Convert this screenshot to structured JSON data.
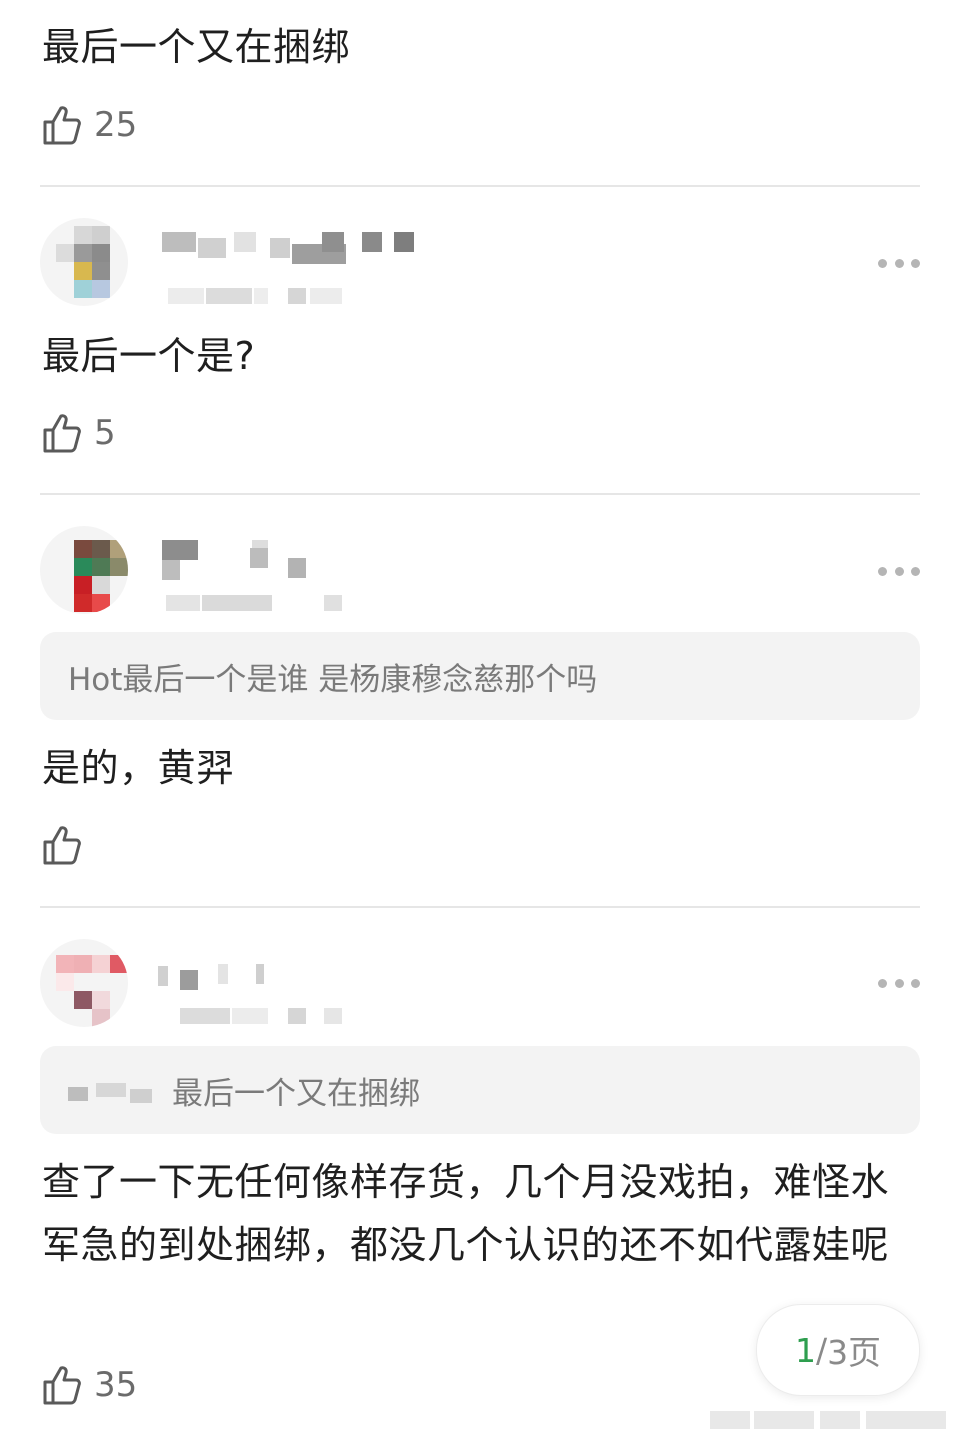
{
  "comments": [
    {
      "text": "最后一个又在捆绑",
      "likes": "25"
    },
    {
      "text": "最后一个是?",
      "likes": "5"
    },
    {
      "quote": "Hot最后一个是谁 是杨康穆念慈那个吗",
      "text": "是的，黄羿",
      "likes": ""
    },
    {
      "quote": "最后一个又在捆绑",
      "text": "查了一下无任何像样存货，几个月没戏拍，难怪水军急的到处捆绑，都没几个认识的还不如代露娃呢",
      "likes": "35"
    }
  ],
  "pager": {
    "current": "1",
    "separator": "/",
    "total_suffix": "3页"
  },
  "icons": {
    "like": "thumbs-up-icon",
    "more": "more-dots-icon"
  },
  "colors": {
    "pager_current": "#2e9e4f",
    "divider": "#e6e6e6",
    "quote_bg": "#f3f3f3"
  }
}
